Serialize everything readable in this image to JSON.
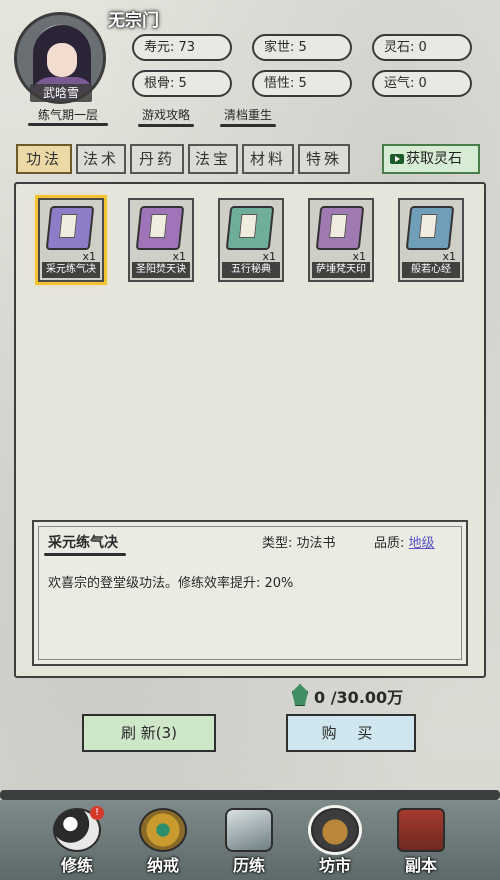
{
  "player": {
    "sect": "无宗门",
    "name": "武晗雪",
    "realm": "练气期一层",
    "stats": [
      {
        "label": "寿元:",
        "value": "73"
      },
      {
        "label": "家世:",
        "value": "5"
      },
      {
        "label": "灵石:",
        "value": "0"
      },
      {
        "label": "根骨:",
        "value": "5"
      },
      {
        "label": "悟性:",
        "value": "5"
      },
      {
        "label": "运气:",
        "value": "0"
      }
    ]
  },
  "links": {
    "guide": "游戏攻略",
    "reset": "清档重生"
  },
  "tabs": [
    "功法",
    "法术",
    "丹药",
    "法宝",
    "材料",
    "特殊"
  ],
  "active_tab": "功法",
  "get_stone_label": "获取灵石",
  "items": [
    {
      "name": "采元练气决",
      "qty": "x1",
      "color": "#8d7cc7"
    },
    {
      "name": "圣阳焚天诀",
      "qty": "x1",
      "color": "#9f74b8"
    },
    {
      "name": "五行秘典",
      "qty": "x1",
      "color": "#6fae9a"
    },
    {
      "name": "萨埵梵天印",
      "qty": "x1",
      "color": "#a07ab3"
    },
    {
      "name": "般若心经",
      "qty": "x1",
      "color": "#6f9fb8"
    }
  ],
  "detail": {
    "name": "采元练气决",
    "type_label": "类型:",
    "type_value": "功法书",
    "quality_label": "品质:",
    "quality_value": "地级",
    "quality_color": "#5b53c9",
    "description": "欢喜宗的登堂级功法。修练效率提升: 20%"
  },
  "price": "0 /30.00万",
  "buttons": {
    "refresh": "刷 新(3)",
    "buy": "购 买"
  },
  "nav": [
    {
      "label": "修练",
      "badge": "!"
    },
    {
      "label": "纳戒"
    },
    {
      "label": "历练"
    },
    {
      "label": "坊市"
    },
    {
      "label": "副本"
    }
  ]
}
